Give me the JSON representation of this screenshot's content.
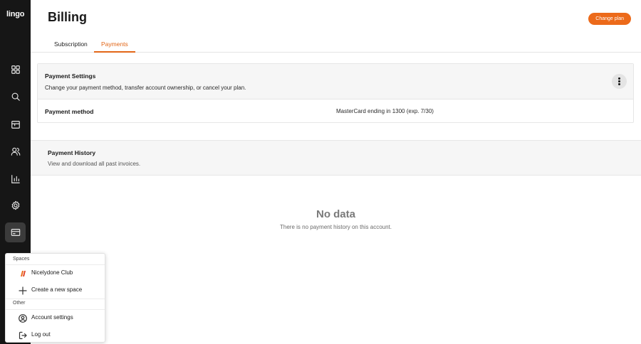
{
  "app": {
    "logo": "lingo"
  },
  "sidebar": {
    "items": [
      {
        "name": "dashboard",
        "icon": "grid-icon",
        "active": false
      },
      {
        "name": "search",
        "icon": "search-icon",
        "active": false
      },
      {
        "name": "library",
        "icon": "box-icon",
        "active": false
      },
      {
        "name": "users",
        "icon": "users-icon",
        "active": false
      },
      {
        "name": "analytics",
        "icon": "chart-icon",
        "active": false
      },
      {
        "name": "settings",
        "icon": "gear-icon",
        "active": false
      },
      {
        "name": "billing",
        "icon": "credit-card-icon",
        "active": true
      }
    ]
  },
  "header": {
    "title": "Billing",
    "change_plan_label": "Change plan"
  },
  "tabs": [
    {
      "label": "Subscription",
      "active": false
    },
    {
      "label": "Payments",
      "active": true
    }
  ],
  "payment_settings": {
    "title": "Payment Settings",
    "description": "Change your payment method, transfer account ownership, or cancel your plan.",
    "method_label": "Payment method",
    "method_value": "MasterCard ending in 1300 (exp. 7/30)"
  },
  "payment_history": {
    "title": "Payment History",
    "description": "View and download all past invoices.",
    "empty_title": "No data",
    "empty_description": "There is no payment history on this account."
  },
  "account_menu": {
    "spaces_heading": "Spaces",
    "spaces": [
      {
        "label": "Nicelydone Club",
        "icon": "space-logo-icon"
      },
      {
        "label": "Create a new space",
        "icon": "plus-icon"
      }
    ],
    "other_heading": "Other",
    "other": [
      {
        "label": "Account settings",
        "icon": "user-circle-icon"
      },
      {
        "label": "Log out",
        "icon": "logout-icon"
      }
    ]
  },
  "colors": {
    "accent": "#e26617",
    "sidebar": "#161616",
    "panel": "#f6f6f6"
  }
}
